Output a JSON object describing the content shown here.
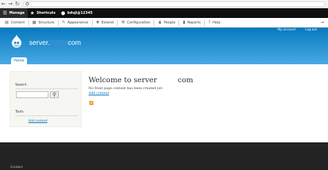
{
  "toolbar": {
    "manage": "Manage",
    "shortcuts": "Shortcuts",
    "user": "bduji@12345"
  },
  "tray": {
    "items": [
      {
        "label": "Content",
        "icon": "content-icon"
      },
      {
        "label": "Structure",
        "icon": "structure-icon"
      },
      {
        "label": "Appearance",
        "icon": "appearance-icon"
      },
      {
        "label": "Extend",
        "icon": "extend-icon"
      },
      {
        "label": "Configuration",
        "icon": "configuration-icon"
      },
      {
        "label": "People",
        "icon": "people-icon"
      },
      {
        "label": "Reports",
        "icon": "reports-icon"
      },
      {
        "label": "Help",
        "icon": "help-icon"
      }
    ]
  },
  "header": {
    "site_name_start": "server.",
    "site_name_end": "com",
    "secondary_menu": [
      "My account",
      "Log out"
    ],
    "home_tab": "Home"
  },
  "sidebar": {
    "search_title": "Search",
    "tools_title": "Tools",
    "add_content": "Add content"
  },
  "main": {
    "title_start": "Welcome to server",
    "title_end": "com",
    "message": "No front page content has been created yet.",
    "add_content": "Add content"
  },
  "footer": {
    "contact": "Contact"
  },
  "colors": {
    "header_blue": "#0779bf",
    "link_blue": "#0071b3",
    "toolbar_black": "#0f0f0f",
    "footer_dark": "#232323"
  }
}
